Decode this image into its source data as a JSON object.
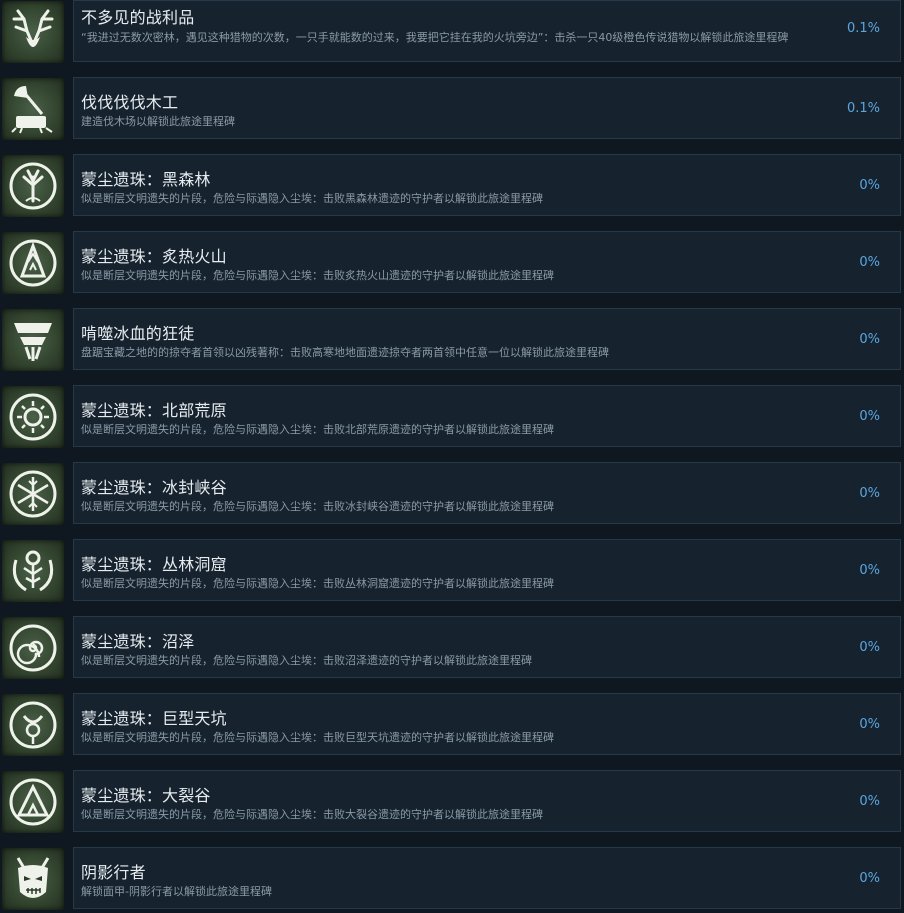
{
  "achievements": [
    {
      "icon": "antler-skull-icon",
      "title": "不多见的战利品",
      "desc": "“我进过无数次密林，遇见这种猎物的次数，一只手就能数的过来，我要把它挂在我的火坑旁边”：击杀一只40级橙色传说猎物以解锁此旅途里程碑",
      "percent": "0.1%"
    },
    {
      "icon": "axe-stump-icon",
      "title": "伐伐伐伐木工",
      "desc": "建造伐木场以解锁此旅途里程碑",
      "percent": "0.1%"
    },
    {
      "icon": "tree-emblem-icon",
      "title": "蒙尘遗珠：黑森林",
      "desc": "似是断层文明遗失的片段，危险与际遇隐入尘埃：击败黑森林遗迹的守护者以解锁此旅途里程碑",
      "percent": "0%"
    },
    {
      "icon": "volcano-emblem-icon",
      "title": "蒙尘遗珠：炙热火山",
      "desc": "似是断层文明遗失的片段，危险与际遇隐入尘埃：击败炙热火山遗迹的守护者以解锁此旅途里程碑",
      "percent": "0%"
    },
    {
      "icon": "mask-emblem-icon",
      "title": "啃噬冰血的狂徒",
      "desc": "盘踞宝藏之地的的掠夺者首领以凶残著称：击败高寒地地面遗迹掠夺者两首领中任意一位以解锁此旅途里程碑",
      "percent": "0%"
    },
    {
      "icon": "sun-emblem-icon",
      "title": "蒙尘遗珠：北部荒原",
      "desc": "似是断层文明遗失的片段，危险与际遇隐入尘埃：击败北部荒原遗迹的守护者以解锁此旅途里程碑",
      "percent": "0%"
    },
    {
      "icon": "snowflake-emblem-icon",
      "title": "蒙尘遗珠：冰封峡谷",
      "desc": "似是断层文明遗失的片段，危险与际遇隐入尘埃：击败冰封峡谷遗迹的守护者以解锁此旅途里程碑",
      "percent": "0%"
    },
    {
      "icon": "vine-emblem-icon",
      "title": "蒙尘遗珠：丛林洞窟",
      "desc": "似是断层文明遗失的片段，危险与际遇隐入尘埃：击败丛林洞窟遗迹的守护者以解锁此旅途里程碑",
      "percent": "0%"
    },
    {
      "icon": "spiral-emblem-icon",
      "title": "蒙尘遗珠：沼泽",
      "desc": "似是断层文明遗失的片段，危险与际遇隐入尘埃：击败沼泽遗迹的守护者以解锁此旅途里程碑",
      "percent": "0%"
    },
    {
      "icon": "moon-emblem-icon",
      "title": "蒙尘遗珠：巨型天坑",
      "desc": "似是断层文明遗失的片段，危险与际遇隐入尘埃：击败巨型天坑遗迹的守护者以解锁此旅途里程碑",
      "percent": "0%"
    },
    {
      "icon": "triangle-emblem-icon",
      "title": "蒙尘遗珠：大裂谷",
      "desc": "似是断层文明遗失的片段，危险与际遇隐入尘埃：击败大裂谷遗迹的守护者以解锁此旅途里程碑",
      "percent": "0%"
    },
    {
      "icon": "demon-mask-icon",
      "title": "阴影行者",
      "desc": "解锁面甲-阴影行者以解锁此旅途里程碑",
      "percent": "0%"
    }
  ],
  "colors": {
    "background": "#0f1820",
    "panel": "#16232e",
    "title": "#e7ecf0",
    "description": "#8a9aa8",
    "percent": "#5ba6e0",
    "icon_bg": "#3a4d37",
    "icon_fg": "#e9eee4"
  }
}
